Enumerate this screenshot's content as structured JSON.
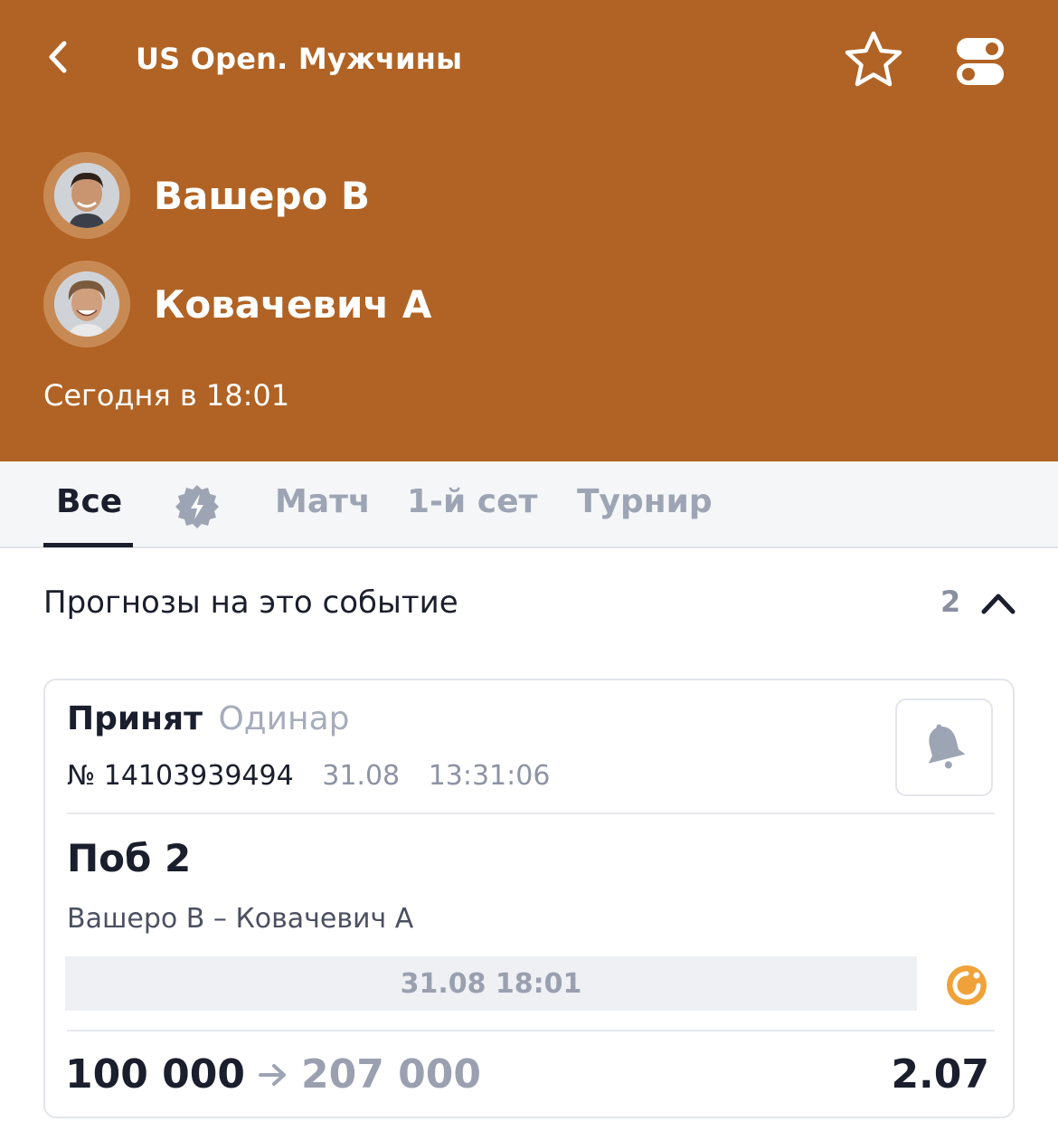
{
  "header": {
    "title": "US Open. Мужчины",
    "players": [
      {
        "name": "Вашеро В"
      },
      {
        "name": "Ковачевич А"
      }
    ],
    "time": "Сегодня в 18:01"
  },
  "tabs": [
    {
      "label": "Все",
      "active": true
    },
    {
      "icon": "lightning-badge-icon"
    },
    {
      "label": "Матч"
    },
    {
      "label": "1-й сет"
    },
    {
      "label": "Турнир"
    }
  ],
  "forecasts": {
    "title": "Прогнозы на это событие",
    "count": "2"
  },
  "bet": {
    "status": "Принят",
    "type": "Одинар",
    "number": "№ 14103939494",
    "date": "31.08",
    "time": "13:31:06",
    "outcome": "Поб 2",
    "event": "Вашеро В – Ковачевич А",
    "event_datetime": "31.08 18:01",
    "stake": "100 000",
    "payout": "207 000",
    "odds": "2.07"
  },
  "colors": {
    "header_bg": "#b06324",
    "accent_orange": "#f0a23a"
  }
}
